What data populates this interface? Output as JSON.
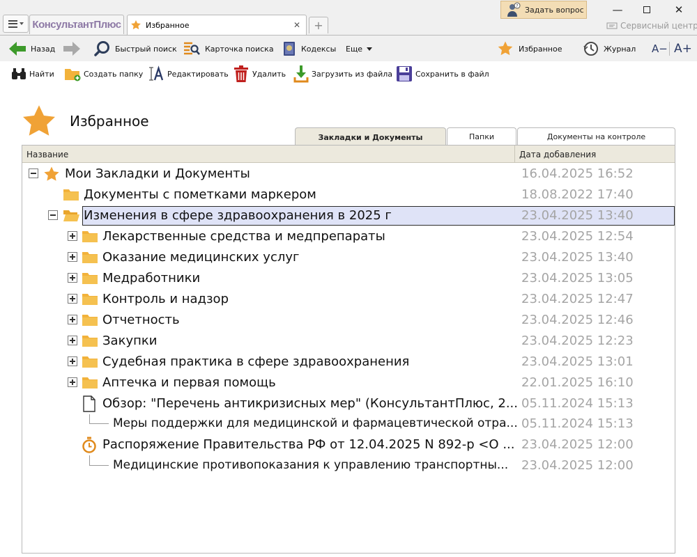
{
  "app": {
    "brand": "КонсультантПлюс",
    "tab_title": "Избранное",
    "ask_button": "Задать вопрос",
    "service_center": "Сервисный центр"
  },
  "toolbar": {
    "back": "Назад",
    "quick_search": "Быстрый поиск",
    "search_card": "Карточка поиска",
    "codes": "Кодексы",
    "more": "Еще",
    "favorites": "Избранное",
    "journal": "Журнал",
    "font_smaller": "A−",
    "font_larger": "A+"
  },
  "actions": {
    "find": "Найти",
    "create_folder": "Создать папку",
    "edit": "Редактировать",
    "delete": "Удалить",
    "load_from_file": "Загрузить из файла",
    "save_to_file": "Сохранить в файл"
  },
  "page": {
    "title": "Избранное",
    "tabs": [
      {
        "label": "Закладки и Документы",
        "active": true
      },
      {
        "label": "Папки",
        "active": false
      },
      {
        "label": "Документы на контроле",
        "active": false
      }
    ]
  },
  "grid": {
    "col_name": "Название",
    "col_date": "Дата добавления",
    "rows": [
      {
        "name": "Мои Закладки и Документы",
        "date": "16.04.2025 16:52",
        "level": 0,
        "expander": "minus",
        "icon": "star-icon"
      },
      {
        "name": "Документы с пометками маркером",
        "date": "18.08.2022 17:40",
        "level": 1,
        "expander": "none",
        "icon": "folder-icon"
      },
      {
        "name": "Изменения в сфере здравоохранения в 2025 г",
        "date": "23.04.2025 13:40",
        "level": 1,
        "expander": "minus",
        "icon": "folder-open-icon",
        "selected": true
      },
      {
        "name": "Лекарственные средства и медпрепараты",
        "date": "23.04.2025 12:54",
        "level": 2,
        "expander": "plus",
        "icon": "folder-icon"
      },
      {
        "name": "Оказание медицинских услуг",
        "date": "23.04.2025 13:40",
        "level": 2,
        "expander": "plus",
        "icon": "folder-icon"
      },
      {
        "name": "Медработники",
        "date": "23.04.2025 13:05",
        "level": 2,
        "expander": "plus",
        "icon": "folder-icon"
      },
      {
        "name": "Контроль и надзор",
        "date": "23.04.2025 12:47",
        "level": 2,
        "expander": "plus",
        "icon": "folder-icon"
      },
      {
        "name": "Отчетность",
        "date": "23.04.2025 12:46",
        "level": 2,
        "expander": "plus",
        "icon": "folder-icon"
      },
      {
        "name": "Закупки",
        "date": "23.04.2025 12:23",
        "level": 2,
        "expander": "plus",
        "icon": "folder-icon"
      },
      {
        "name": "Судебная практика в сфере здравоохранения",
        "date": "23.04.2025 13:01",
        "level": 2,
        "expander": "plus",
        "icon": "folder-icon"
      },
      {
        "name": "Аптечка и первая помощь",
        "date": "22.01.2025 16:10",
        "level": 2,
        "expander": "plus",
        "icon": "folder-icon"
      },
      {
        "name": "Обзор: \"Перечень антикризисных мер\" (КонсультантПлюс, 2...",
        "date": "05.11.2024 15:13",
        "level": 2,
        "expander": "none",
        "icon": "document-icon"
      },
      {
        "name": "Меры поддержки для медицинской и фармацевтической отра...",
        "date": "05.11.2024 15:13",
        "level": 3,
        "expander": "none",
        "icon": "bookmark-line-icon"
      },
      {
        "name": "Распоряжение Правительства РФ от 12.04.2025 N 892-р <О ...",
        "date": "23.04.2025 12:00",
        "level": 2,
        "expander": "none",
        "icon": "stopwatch-icon"
      },
      {
        "name": "Медицинские противопоказания к управлению транспортны...",
        "date": "23.04.2025 12:00",
        "level": 3,
        "expander": "none",
        "icon": "bookmark-line-icon"
      }
    ]
  }
}
